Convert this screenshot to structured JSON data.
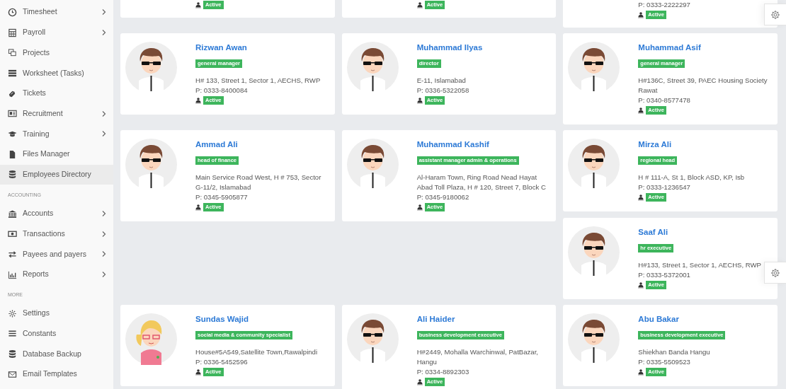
{
  "sidebar": {
    "groups": [
      {
        "items": [
          {
            "label": "Timesheet",
            "has_submenu": true,
            "selected": false
          },
          {
            "label": "Payroll",
            "has_submenu": true,
            "selected": false
          },
          {
            "label": "Projects",
            "has_submenu": false,
            "selected": false
          },
          {
            "label": "Worksheet (Tasks)",
            "has_submenu": false,
            "selected": false
          },
          {
            "label": "Tickets",
            "has_submenu": false,
            "selected": false
          },
          {
            "label": "Recruitment",
            "has_submenu": true,
            "selected": false
          },
          {
            "label": "Training",
            "has_submenu": true,
            "selected": false
          },
          {
            "label": "Files Manager",
            "has_submenu": false,
            "selected": false
          },
          {
            "label": "Employees Directory",
            "has_submenu": false,
            "selected": true
          }
        ]
      },
      {
        "heading": "ACCOUNTING",
        "items": [
          {
            "label": "Accounts",
            "has_submenu": true,
            "selected": false
          },
          {
            "label": "Transactions",
            "has_submenu": true,
            "selected": false
          },
          {
            "label": "Payees and payers",
            "has_submenu": true,
            "selected": false
          },
          {
            "label": "Reports",
            "has_submenu": true,
            "selected": false
          }
        ]
      },
      {
        "heading": "MORE",
        "items": [
          {
            "label": "Settings",
            "has_submenu": false,
            "selected": false
          },
          {
            "label": "Constants",
            "has_submenu": false,
            "selected": false
          },
          {
            "label": "Database Backup",
            "has_submenu": false,
            "selected": false
          },
          {
            "label": "Email Templates",
            "has_submenu": false,
            "selected": false
          }
        ]
      }
    ]
  },
  "card_rows": [
    {
      "columns": [
        {
          "cards": [
            {
              "status": "Active"
            }
          ]
        },
        {
          "cards": [
            {
              "status": "Active"
            }
          ]
        },
        {
          "cards": [
            {
              "phone": "P: 0333-2222297",
              "status": "Active"
            }
          ]
        }
      ]
    },
    {
      "columns": [
        {
          "cards": [
            {
              "kind": "male",
              "name": "Rizwan Awan",
              "role": "general manager",
              "address": "H# 133, Street 1, Sector 1, AECHS, RWP",
              "phone": "P: 0333-8400084",
              "status": "Active"
            }
          ]
        },
        {
          "cards": [
            {
              "kind": "male",
              "name": "Muhammad Ilyas",
              "role": "director",
              "address": "E-11, Islamabad",
              "phone": "P: 0336-5322058",
              "status": "Active"
            }
          ]
        },
        {
          "cards": [
            {
              "kind": "male",
              "name": "Muhammad Asif",
              "role": "general manager",
              "address": "H#136C, Street 39, PAEC Housing Society Rawat",
              "phone": "P: 0340-8577478",
              "status": "Active"
            }
          ]
        }
      ]
    },
    {
      "columns": [
        {
          "cards": [
            {
              "kind": "male",
              "name": "Ammad Ali",
              "role": "head of finance",
              "address": "Main Service Road West, H # 753, Sector G-11/2, Islamabad",
              "phone": "P: 0345-5905877",
              "status": "Active"
            }
          ]
        },
        {
          "cards": [
            {
              "kind": "male",
              "name": "Muhammad Kashif",
              "role": "assistant manager admin & operations",
              "address": "Al-Haram Town, Ring Road Nead Hayat Abad Toll Plaza, H # 120, Street 7, Block C",
              "phone": "P: 0345-9180062",
              "status": "Active"
            }
          ]
        },
        {
          "cards": [
            {
              "kind": "male",
              "name": "Mirza Ali",
              "role": "regional head",
              "address": "H # 111-A, St 1, Block ASD, KP, Isb",
              "phone": "P: 0333-1236547",
              "status": "Active"
            },
            {
              "kind": "male",
              "name": "Saaf Ali",
              "role": "hr executive",
              "address": "H#133, Street 1, Sector 1, AECHS, RWP",
              "phone": "P: 0333-5372001",
              "status": "Active"
            }
          ]
        }
      ]
    },
    {
      "columns": [
        {
          "cards": [
            {
              "kind": "female",
              "name": "Sundas Wajid",
              "role": "social media & community specialist",
              "address": "House#5A549,Satellite Town,Rawalpindi",
              "phone": "P: 0336-5452596",
              "status": "Active"
            }
          ]
        },
        {
          "cards": [
            {
              "kind": "male",
              "name": "Ali Haider",
              "role": "business development executive",
              "address": "H#2449, Mohalla Warchinwal, PatBazar, Hangu",
              "phone": "P: 0334-8892303",
              "status": "Active"
            }
          ]
        },
        {
          "cards": [
            {
              "kind": "male",
              "name": "Abu Bakar",
              "role": "business development executive",
              "address": "Shiekhan Banda Hangu",
              "phone": "P: 0335-5509523",
              "status": "Active"
            }
          ]
        }
      ]
    }
  ]
}
